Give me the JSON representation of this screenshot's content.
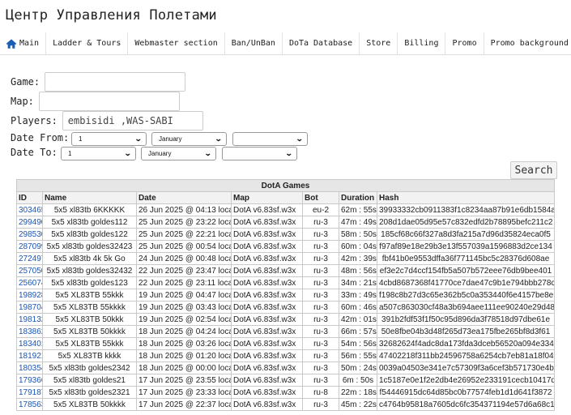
{
  "site_title": "Центр Управления Полетами",
  "nav": [
    "Main",
    "Ladder & Tours",
    "Webmaster section",
    "Ban/UnBan",
    "DoTa Database",
    "Store",
    "Billing",
    "Promo",
    "Promo background"
  ],
  "form": {
    "game_label": "Game:",
    "map_label": "Map:",
    "players_label": "Players:",
    "players_value": "embisidi ,WAS-SABI",
    "date_from_label": "Date From:",
    "date_to_label": "Date To:",
    "from_day": "1",
    "from_month": "January",
    "from_year": "",
    "to_day": "1",
    "to_month": "January",
    "to_year": "",
    "search_label": "Search"
  },
  "table": {
    "caption": "DotA Games",
    "headers": [
      "ID",
      "Name",
      "Date",
      "Map",
      "Bot",
      "Duration",
      "Hash"
    ],
    "rows": [
      [
        "303465",
        "5x5 xl83tb 6KKKKK",
        "26 Jun 2025 @ 04:13 local",
        "DotA v6.83sf.w3x",
        "eu-2",
        "62m : 55s",
        "39933332cb0911383f1c8234aa87b91e6db1584a"
      ],
      [
        "299490",
        "5x5 xl83tb goldes112",
        "25 Jun 2025 @ 23:22 local",
        "DotA v6.83sf.w3x",
        "ru-3",
        "47m : 49s",
        "208d1dae05d95e57c832edfd2b78895befc211c2"
      ],
      [
        "298530",
        "5x5 xl83tb goldes122",
        "25 Jun 2025 @ 22:21 local",
        "DotA v6.83sf.w3x",
        "ru-3",
        "58m : 50s",
        "185cf68c66f327a8d3fa215a7d96d35824eca0f5"
      ],
      [
        "287099",
        "5x5 xl83tb goldes32423",
        "25 Jun 2025 @ 00:54 local",
        "DotA v6.83sf.w3x",
        "ru-3",
        "60m : 04s",
        "f97af89e18e29b3e13f557039a1596883d2ce134"
      ],
      [
        "272497",
        "5x5 xl83tb 4k 5k Go",
        "24 Jun 2025 @ 00:48 local",
        "DotA v6.83sf.w3x",
        "ru-3",
        "42m : 39s",
        "fbf41b0e9553dffa36f771145bc5c28376d608ae"
      ],
      [
        "257050",
        "5x5 xl83tb goldes32432",
        "22 Jun 2025 @ 23:47 local",
        "DotA v6.83sf.w3x",
        "ru-3",
        "48m : 56s",
        "ef3e2c7d4ccf154fb5a507b572eee76db9bee401"
      ],
      [
        "256074",
        "5x5 xl83tb goldes123",
        "22 Jun 2025 @ 23:11 local",
        "DotA v6.83sf.w3x",
        "ru-3",
        "34m : 21s",
        "4cbd8687368f41770ce7dae47c9b1e794bbb278c"
      ],
      [
        "198928",
        "5x5 XL83TB 55kkk",
        "19 Jun 2025 @ 04:47 local",
        "DotA v6.83sf.w3x",
        "ru-3",
        "33m : 49s",
        "f198c8b27d3c65e362b5c0a353440f6e4157be8e"
      ],
      [
        "198704",
        "5x5 XL83TB 55kkkk",
        "19 Jun 2025 @ 03:43 local",
        "DotA v6.83sf.w3x",
        "ru-3",
        "60m : 46s",
        "a507c863030cf48a3b694aee111ee90240e29d48"
      ],
      [
        "198132",
        "5x5 XL83TB 50kkk",
        "19 Jun 2025 @ 02:54 local",
        "DotA v6.83sf.w3x",
        "ru-3",
        "42m : 01s",
        "391b2fdf53f1f50c95d896da3f78518d97dbe61e"
      ],
      [
        "183862",
        "5x5 XL83TB 50kkkk",
        "18 Jun 2025 @ 04:24 local",
        "DotA v6.83sf.w3x",
        "ru-3",
        "66m : 57s",
        "50e8fbe04b3d48f265d73ea175fbe265bf8d3f61"
      ],
      [
        "183401",
        "5x5 XL83TB 55kkk",
        "18 Jun 2025 @ 03:26 local",
        "DotA v6.83sf.w3x",
        "ru-3",
        "54m : 56s",
        "32682624f4adc8da173fda3dceb56520a094e334"
      ],
      [
        "181921",
        "5x5 XL83TB kkkk",
        "18 Jun 2025 @ 01:20 local",
        "DotA v6.83sf.w3x",
        "ru-3",
        "56m : 55s",
        "47402218f311bb24596758a6254cb7eb81a18f04"
      ],
      [
        "180354",
        "5x5 xl83tb goldes2342",
        "18 Jun 2025 @ 00:00 local",
        "DotA v6.83sf.w3x",
        "ru-3",
        "50m : 24s",
        "0039a04503e341e7c57309f3a6cef3b571730e4b"
      ],
      [
        "179366",
        "5x5 xl83tb goldes21",
        "17 Jun 2025 @ 23:55 local",
        "DotA v6.83sf.w3x",
        "ru-3",
        "6m : 50s",
        "1c5187e0e1f2e2db4e26952e233191cecb10417d"
      ],
      [
        "179187",
        "5x5 xl83tb goldes2321",
        "17 Jun 2025 @ 23:33 local",
        "DotA v6.83sf.w3x",
        "ru-8",
        "22m : 18s",
        "f54446915dc64d85bc0b77574feb1d1d641f3872"
      ],
      [
        "178563",
        "5x5 XL83TB 50kkkk",
        "17 Jun 2025 @ 22:37 local",
        "DotA v6.83sf.w3x",
        "ru-3",
        "45m : 22s",
        "c4764b95818a7605dc6fc354371194e57d6a68c1"
      ]
    ]
  }
}
